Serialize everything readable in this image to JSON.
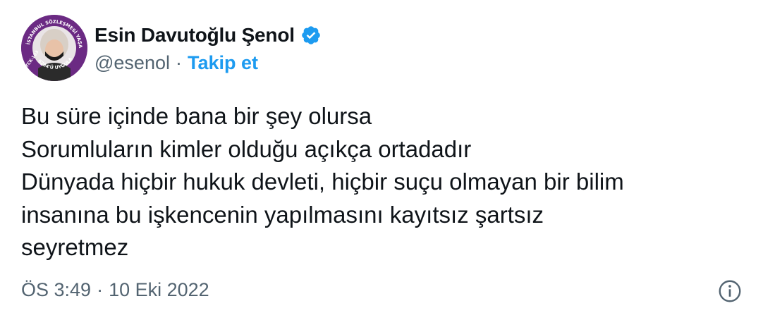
{
  "author": {
    "display_name": "Esin Davutoğlu Şenol",
    "handle": "@esenol",
    "separator": "·",
    "follow_label": "Takip et",
    "verified": true,
    "avatar_badge_text": {
      "top": "İSTANBUL SÖZLEŞMESİ YAŞATIR",
      "left": "TCK-103",
      "bottom": "6284'Ü UYGULA"
    }
  },
  "tweet": {
    "lines": [
      "Bu süre içinde bana bir şey olursa",
      "Sorumluların kimler olduğu açıkça ortadadır",
      "Dünyada hiçbir hukuk devleti, hiçbir suçu olmayan bir bilim",
      "insanına bu işkencenin yapılmasını kayıtsız şartsız",
      "seyretmez"
    ]
  },
  "footer": {
    "time": "ÖS 3:49",
    "separator": "·",
    "date": "10 Eki 2022"
  },
  "icons": {
    "verified": "verified-badge-icon",
    "info": "info-icon"
  },
  "colors": {
    "link": "#1d9bf0",
    "muted": "#536471",
    "text": "#0f1419",
    "avatar_ring": "#6b2a83"
  }
}
